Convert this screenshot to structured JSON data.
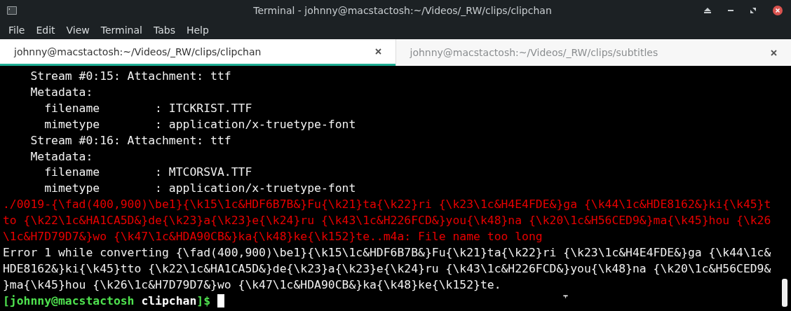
{
  "window": {
    "title": "Terminal - johnny@macstactosh:~/Videos/_RW/clips/clipchan"
  },
  "menu": [
    "File",
    "Edit",
    "View",
    "Terminal",
    "Tabs",
    "Help"
  ],
  "tabs": [
    {
      "label": "johnny@macstactosh:~/Videos/_RW/clips/clipchan",
      "selected": true
    },
    {
      "label": "johnny@macstactosh:~/Videos/_RW/clips/subtitles",
      "selected": false
    }
  ],
  "terminal": {
    "lines": [
      {
        "kind": "output",
        "text": "    Stream #0:15: Attachment: ttf"
      },
      {
        "kind": "output",
        "text": "    Metadata:"
      },
      {
        "kind": "output",
        "text": "      filename        : ITCKRIST.TTF"
      },
      {
        "kind": "output",
        "text": "      mimetype        : application/x-truetype-font"
      },
      {
        "kind": "output",
        "text": "    Stream #0:16: Attachment: ttf"
      },
      {
        "kind": "output",
        "text": "    Metadata:"
      },
      {
        "kind": "output",
        "text": "      filename        : MTCORSVA.TTF"
      },
      {
        "kind": "output",
        "text": "      mimetype        : application/x-truetype-font"
      },
      {
        "kind": "error",
        "text": "./0019-{\\fad(400,900)\\be1}{\\k15\\1c&HDF6B7B&}Fu{\\k21}ta{\\k22}ri {\\k23\\1c&H4E4FDE&}ga {\\k44\\1c&HDE8162&}ki{\\k45}t"
      },
      {
        "kind": "error",
        "text": "to {\\k22\\1c&HA1CA5D&}de{\\k23}a{\\k23}e{\\k24}ru {\\k43\\1c&H226FCD&}you{\\k48}na {\\k20\\1c&H56CED9&}ma{\\k45}hou {\\k26"
      },
      {
        "kind": "error",
        "text": "\\1c&H7D79D7&}wo {\\k47\\1c&HDA90CB&}ka{\\k48}ke{\\k152}te..m4a: File name too long"
      },
      {
        "kind": "output",
        "text": "Error 1 while converting {\\fad(400,900)\\be1}{\\k15\\1c&HDF6B7B&}Fu{\\k21}ta{\\k22}ri {\\k23\\1c&H4E4FDE&}ga {\\k44\\1c&"
      },
      {
        "kind": "output",
        "text": "HDE8162&}ki{\\k45}tto {\\k22\\1c&HA1CA5D&}de{\\k23}a{\\k23}e{\\k24}ru {\\k43\\1c&H226FCD&}you{\\k48}na {\\k20\\1c&H56CED9&"
      },
      {
        "kind": "output",
        "text": "}ma{\\k45}hou {\\k26\\1c&H7D79D7&}wo {\\k47\\1c&HDA90CB&}ka{\\k48}ke{\\k152}te."
      }
    ],
    "prompt": {
      "user_host": "[johnny@macstactosh",
      "directory": "clipchan",
      "symbol": "]$"
    }
  }
}
